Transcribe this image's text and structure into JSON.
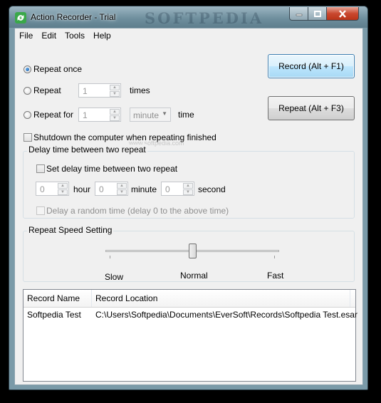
{
  "window": {
    "title": "Action Recorder - Trial",
    "watermark": "SOFTPEDIA",
    "watermark_small": "www.softpedia.com"
  },
  "menu": [
    "File",
    "Edit",
    "Tools",
    "Help"
  ],
  "repeat": {
    "once_label": "Repeat once",
    "repeat_label": "Repeat",
    "repeat_value": "1",
    "times_label": "times",
    "repeat_for_label": "Repeat for",
    "repeat_for_value": "1",
    "unit_value": "minute",
    "time_label": "time",
    "selected": "once"
  },
  "buttons": {
    "record": "Record (Alt + F1)",
    "repeat": "Repeat (Alt + F3)"
  },
  "shutdown_label": "Shutdown the computer when repeating finished",
  "delay": {
    "group_title": "Delay time between two repeat",
    "set_delay_label": "Set delay time between two repeat",
    "hour_value": "0",
    "hour_label": "hour",
    "minute_value": "0",
    "minute_label": "minute",
    "second_value": "0",
    "second_label": "second",
    "random_label": "Delay a random time (delay 0 to the above time)"
  },
  "speed": {
    "group_title": "Repeat Speed Setting",
    "slow": "Slow",
    "normal": "Normal",
    "fast": "Fast",
    "level": 0.5
  },
  "records": {
    "columns": [
      "Record Name",
      "Record Location"
    ],
    "rows": [
      {
        "name": "Softpedia Test",
        "location": "C:\\Users\\Softpedia\\Documents\\EverSoft\\Records\\Softpedia Test.esar"
      }
    ]
  }
}
